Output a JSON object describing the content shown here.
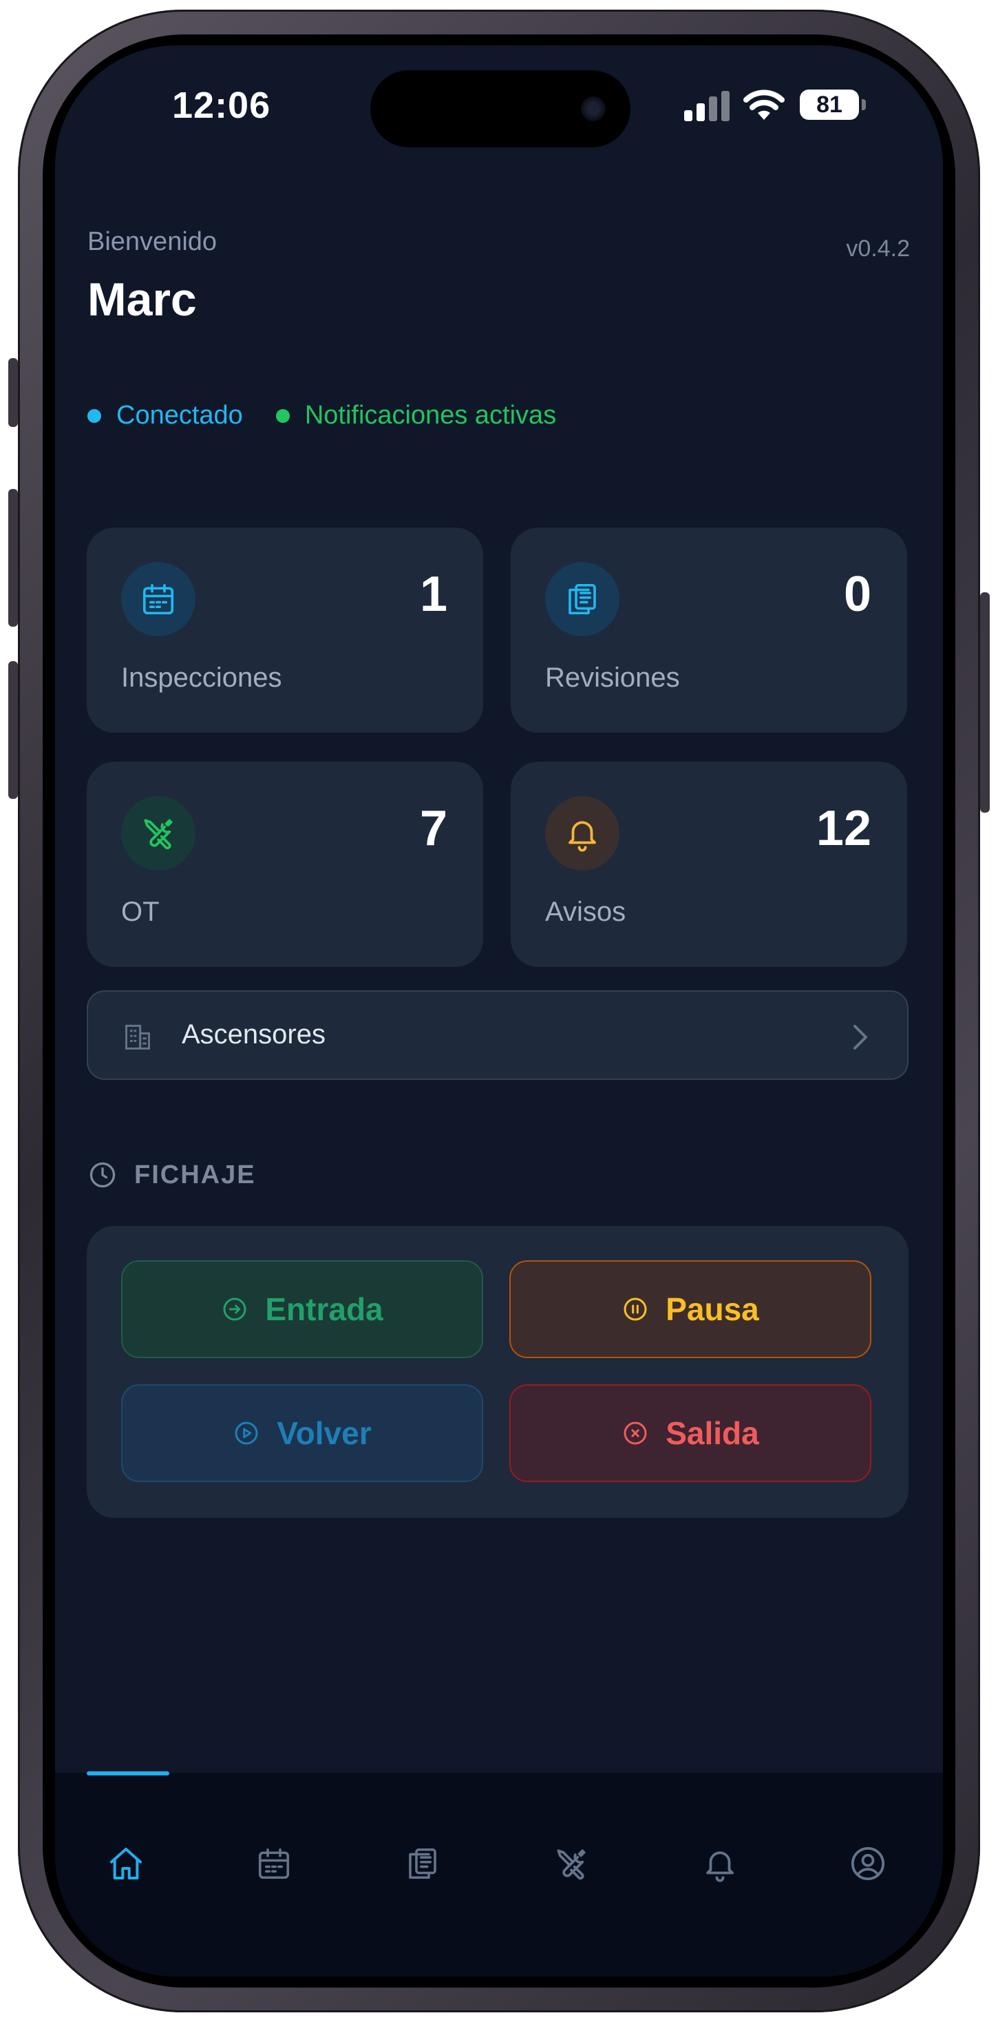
{
  "status_bar": {
    "time": "12:06",
    "battery": "81"
  },
  "header": {
    "greeting": "Bienvenido",
    "user_name": "Marc",
    "version": "v0.4.2"
  },
  "status": {
    "connected": "Conectado",
    "notifications": "Notificaciones activas"
  },
  "stats": [
    {
      "label": "Inspecciones",
      "value": "1",
      "icon": "calendar-icon",
      "accent": "#22b8f0"
    },
    {
      "label": "Revisiones",
      "value": "0",
      "icon": "clipboard-icon",
      "accent": "#22b8f0"
    },
    {
      "label": "OT",
      "value": "7",
      "icon": "tools-icon",
      "accent": "#22c55e"
    },
    {
      "label": "Avisos",
      "value": "12",
      "icon": "bell-icon",
      "accent": "#f5b53a"
    }
  ],
  "elevators_link": {
    "label": "Ascensores",
    "icon": "building-icon"
  },
  "clock_section": {
    "title": "FICHAJE",
    "buttons": {
      "entrada": "Entrada",
      "pausa": "Pausa",
      "volver": "Volver",
      "salida": "Salida"
    }
  },
  "tabbar": {
    "active": "home",
    "items": [
      "home-icon",
      "calendar-icon",
      "clipboard-icon",
      "tools-icon",
      "bell-icon",
      "profile-icon"
    ]
  },
  "colors": {
    "background": "#0f1729",
    "card": "#1e293b",
    "accent_blue": "#22b8f0",
    "accent_green": "#22c55e",
    "accent_amber": "#fbbf24",
    "accent_red": "#f05c5c"
  }
}
